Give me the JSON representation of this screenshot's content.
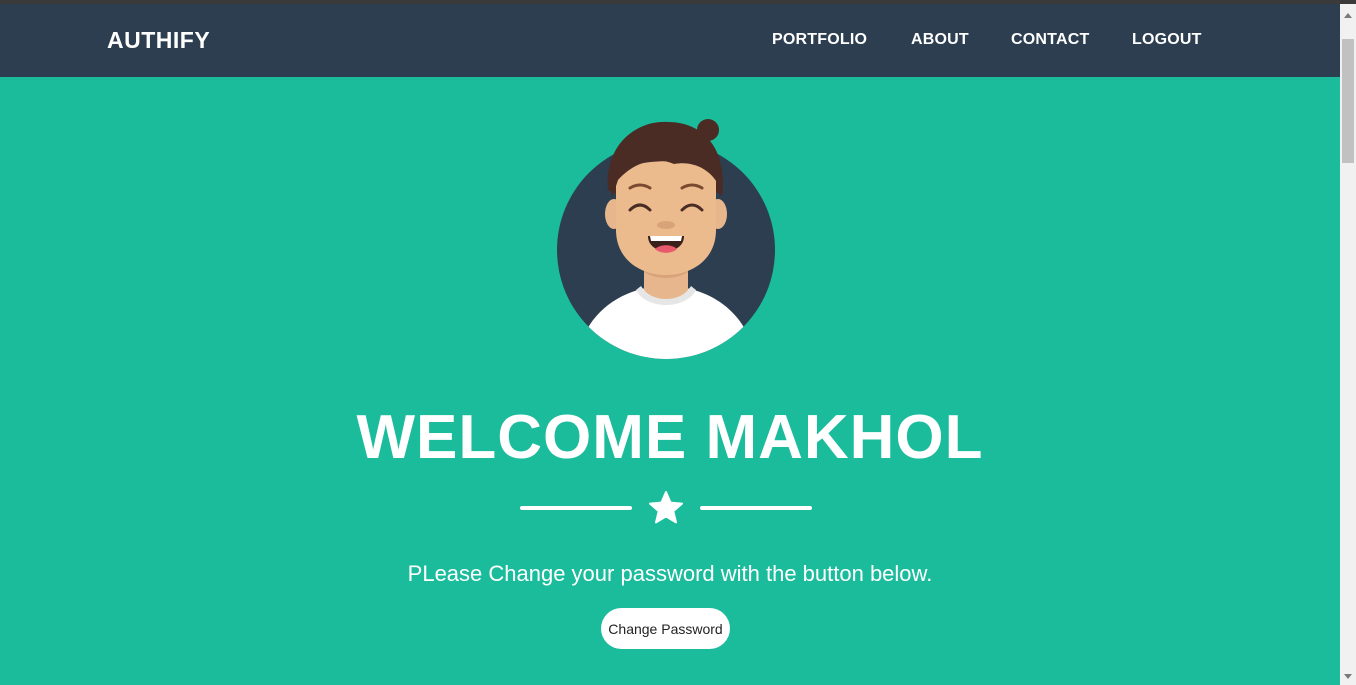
{
  "navbar": {
    "brand": "AUTHIFY",
    "links": [
      "PORTFOLIO",
      "ABOUT",
      "CONTACT",
      "LOGOUT"
    ]
  },
  "masthead": {
    "heading": "WELCOME MAKHOL",
    "divider_icon": "star-icon",
    "subtitle": "PLease Change your password with the button below.",
    "button_label": "Change Password"
  },
  "colors": {
    "navbar_bg": "#2c3e50",
    "page_bg": "#1abc9c",
    "text": "#ffffff"
  }
}
